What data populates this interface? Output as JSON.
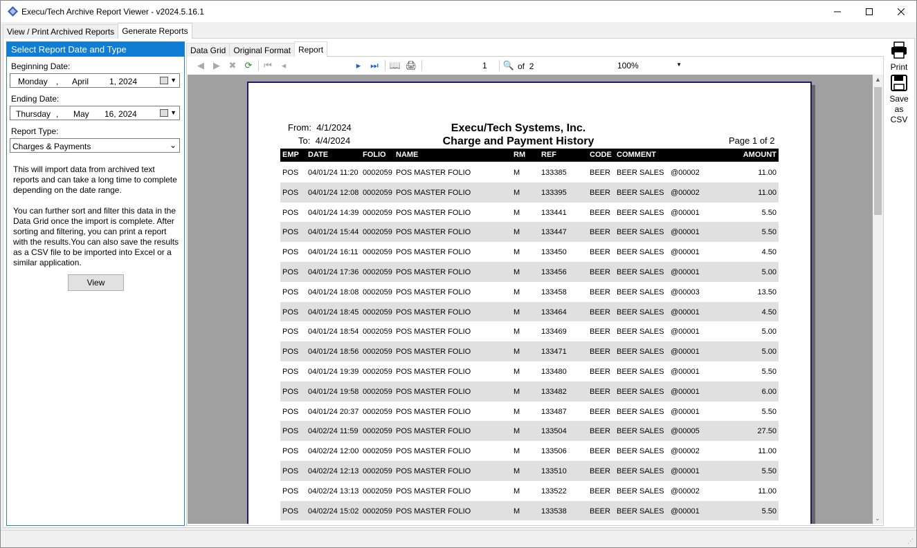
{
  "window": {
    "title": "Execu/Tech Archive Report Viewer - v2024.5.16.1",
    "minimize_icon": "minimize-icon",
    "maximize_icon": "maximize-icon",
    "close_icon": "close-icon"
  },
  "top_tabs": [
    {
      "label": "View / Print Archived Reports",
      "active": false
    },
    {
      "label": "Generate Reports",
      "active": true
    }
  ],
  "left_panel": {
    "header": "Select Report Date and Type",
    "beginning_label": "Beginning Date:",
    "beginning": {
      "weekday": "Monday",
      "sep": ",",
      "month": "April",
      "day_year": "1, 2024"
    },
    "ending_label": "Ending Date:",
    "ending": {
      "weekday": "Thursday",
      "sep": ",",
      "month": "May",
      "day_year": "16, 2024"
    },
    "report_type_label": "Report Type:",
    "report_type": "Charges & Payments",
    "help_1": "This will import data from archived text reports and can take a long time to complete depending on the date range.",
    "help_2": "You can further sort and filter this data in the Data Grid once the import is complete. After sorting and filtering, you can print a report with the results.You can also save the results as a CSV file to be imported into Excel or a similar application.",
    "view_button": "View"
  },
  "inner_tabs": [
    {
      "label": "Data Grid",
      "active": false
    },
    {
      "label": "Original Format",
      "active": false
    },
    {
      "label": "Report",
      "active": true
    }
  ],
  "toolbar": {
    "page": "1",
    "of_label": "of",
    "total_pages": "2",
    "zoom": "100%"
  },
  "report": {
    "from_label": "From:",
    "from": "4/1/2024",
    "to_label": "To:",
    "to": "4/4/2024",
    "company": "Execu/Tech Systems, Inc.",
    "title": "Charge and Payment History",
    "page_label": "Page 1 of 2",
    "columns": [
      "EMP",
      "DATE",
      "FOLIO",
      "NAME",
      "RM",
      "REF",
      "CODE",
      "COMMENT",
      "AMOUNT"
    ],
    "rows": [
      {
        "emp": "POS",
        "date": "04/01/24 11:20",
        "folio": "0002059",
        "name": "POS MASTER FOLIO",
        "rm": "M",
        "ref": "133385",
        "code": "BEER",
        "comment": "BEER SALES",
        "extra": "@00002",
        "amount": "11.00"
      },
      {
        "emp": "POS",
        "date": "04/01/24 12:08",
        "folio": "0002059",
        "name": "POS MASTER FOLIO",
        "rm": "M",
        "ref": "133395",
        "code": "BEER",
        "comment": "BEER SALES",
        "extra": "@00002",
        "amount": "11.00"
      },
      {
        "emp": "POS",
        "date": "04/01/24 14:39",
        "folio": "0002059",
        "name": "POS MASTER FOLIO",
        "rm": "M",
        "ref": "133441",
        "code": "BEER",
        "comment": "BEER SALES",
        "extra": "@00001",
        "amount": "5.50"
      },
      {
        "emp": "POS",
        "date": "04/01/24 15:44",
        "folio": "0002059",
        "name": "POS MASTER FOLIO",
        "rm": "M",
        "ref": "133447",
        "code": "BEER",
        "comment": "BEER SALES",
        "extra": "@00001",
        "amount": "5.50"
      },
      {
        "emp": "POS",
        "date": "04/01/24 16:11",
        "folio": "0002059",
        "name": "POS MASTER FOLIO",
        "rm": "M",
        "ref": "133450",
        "code": "BEER",
        "comment": "BEER SALES",
        "extra": "@00001",
        "amount": "4.50"
      },
      {
        "emp": "POS",
        "date": "04/01/24 17:36",
        "folio": "0002059",
        "name": "POS MASTER FOLIO",
        "rm": "M",
        "ref": "133456",
        "code": "BEER",
        "comment": "BEER SALES",
        "extra": "@00001",
        "amount": "5.00"
      },
      {
        "emp": "POS",
        "date": "04/01/24 18:08",
        "folio": "0002059",
        "name": "POS MASTER FOLIO",
        "rm": "M",
        "ref": "133458",
        "code": "BEER",
        "comment": "BEER SALES",
        "extra": "@00003",
        "amount": "13.50"
      },
      {
        "emp": "POS",
        "date": "04/01/24 18:45",
        "folio": "0002059",
        "name": "POS MASTER FOLIO",
        "rm": "M",
        "ref": "133464",
        "code": "BEER",
        "comment": "BEER SALES",
        "extra": "@00001",
        "amount": "4.50"
      },
      {
        "emp": "POS",
        "date": "04/01/24 18:54",
        "folio": "0002059",
        "name": "POS MASTER FOLIO",
        "rm": "M",
        "ref": "133469",
        "code": "BEER",
        "comment": "BEER SALES",
        "extra": "@00001",
        "amount": "5.00"
      },
      {
        "emp": "POS",
        "date": "04/01/24 18:56",
        "folio": "0002059",
        "name": "POS MASTER FOLIO",
        "rm": "M",
        "ref": "133471",
        "code": "BEER",
        "comment": "BEER SALES",
        "extra": "@00001",
        "amount": "5.00"
      },
      {
        "emp": "POS",
        "date": "04/01/24 19:39",
        "folio": "0002059",
        "name": "POS MASTER FOLIO",
        "rm": "M",
        "ref": "133480",
        "code": "BEER",
        "comment": "BEER SALES",
        "extra": "@00001",
        "amount": "5.50"
      },
      {
        "emp": "POS",
        "date": "04/01/24 19:58",
        "folio": "0002059",
        "name": "POS MASTER FOLIO",
        "rm": "M",
        "ref": "133482",
        "code": "BEER",
        "comment": "BEER SALES",
        "extra": "@00001",
        "amount": "6.00"
      },
      {
        "emp": "POS",
        "date": "04/01/24 20:37",
        "folio": "0002059",
        "name": "POS MASTER FOLIO",
        "rm": "M",
        "ref": "133487",
        "code": "BEER",
        "comment": "BEER SALES",
        "extra": "@00001",
        "amount": "5.50"
      },
      {
        "emp": "POS",
        "date": "04/02/24 11:59",
        "folio": "0002059",
        "name": "POS MASTER FOLIO",
        "rm": "M",
        "ref": "133504",
        "code": "BEER",
        "comment": "BEER SALES",
        "extra": "@00005",
        "amount": "27.50"
      },
      {
        "emp": "POS",
        "date": "04/02/24 12:00",
        "folio": "0002059",
        "name": "POS MASTER FOLIO",
        "rm": "M",
        "ref": "133506",
        "code": "BEER",
        "comment": "BEER SALES",
        "extra": "@00002",
        "amount": "11.00"
      },
      {
        "emp": "POS",
        "date": "04/02/24 12:13",
        "folio": "0002059",
        "name": "POS MASTER FOLIO",
        "rm": "M",
        "ref": "133510",
        "code": "BEER",
        "comment": "BEER SALES",
        "extra": "@00001",
        "amount": "5.50"
      },
      {
        "emp": "POS",
        "date": "04/02/24 13:13",
        "folio": "0002059",
        "name": "POS MASTER FOLIO",
        "rm": "M",
        "ref": "133522",
        "code": "BEER",
        "comment": "BEER SALES",
        "extra": "@00002",
        "amount": "11.00"
      },
      {
        "emp": "POS",
        "date": "04/02/24 15:02",
        "folio": "0002059",
        "name": "POS MASTER FOLIO",
        "rm": "M",
        "ref": "133538",
        "code": "BEER",
        "comment": "BEER SALES",
        "extra": "@00001",
        "amount": "5.50"
      }
    ]
  },
  "side_actions": {
    "print_label": "Print",
    "save_label_1": "Save",
    "save_label_2": "as",
    "save_label_3": "CSV"
  },
  "colors": {
    "header_blue": "#0f7dd3",
    "report_border": "#1a1a6e",
    "row_alt": "#e0e0e0"
  }
}
